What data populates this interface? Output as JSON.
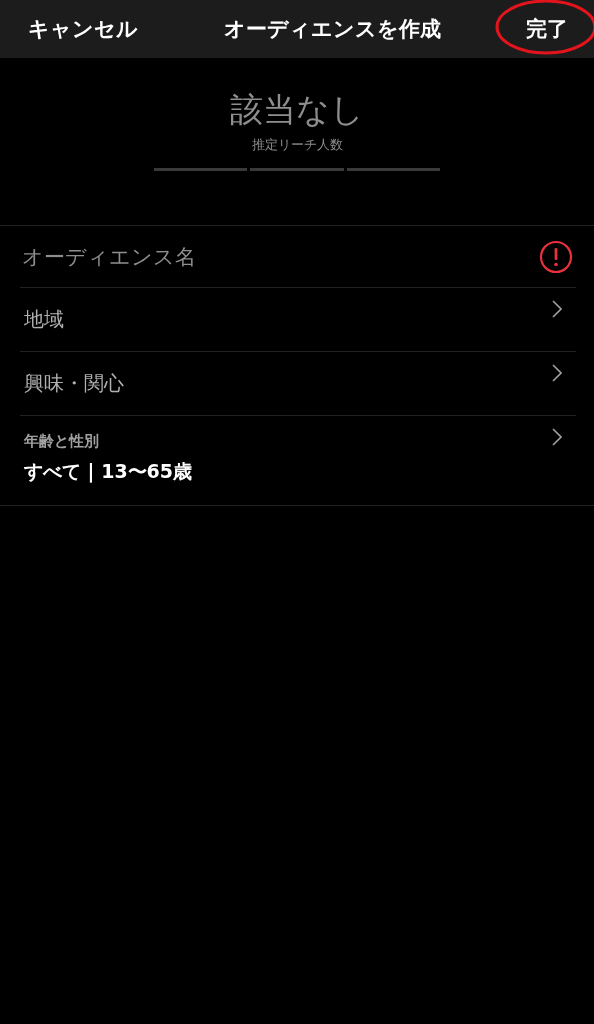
{
  "header": {
    "cancel": "キャンセル",
    "title": "オーディエンスを作成",
    "done": "完了",
    "done_circled": true
  },
  "reach": {
    "value": "該当なし",
    "label": "推定リーチ人数"
  },
  "form": [
    {
      "kind": "field",
      "placeholder": "オーディエンス名",
      "error": true
    },
    {
      "kind": "link",
      "label": "地域"
    },
    {
      "kind": "link",
      "label": "興味・関心"
    },
    {
      "kind": "detail",
      "label": "年齢と性別",
      "value": "すべて | 13〜65歳"
    }
  ]
}
